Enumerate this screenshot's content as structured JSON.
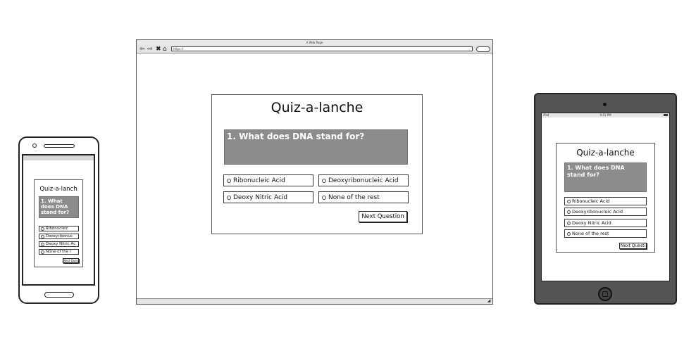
{
  "quiz": {
    "title": "Quiz-a-lanche",
    "question": "1. What does DNA stand for?",
    "options": [
      "Ribonucleic Acid",
      "Deoxyribonucleic Acid",
      "Deoxy Nitric Acid",
      "None of the rest"
    ],
    "next_label": "Next Question"
  },
  "phone": {
    "title": "Quiz-a-lanch",
    "question": "1. What does DNA stand for?",
    "options": [
      "Ribonucleic",
      "Deoxyribonuc",
      "Deoxy Nitric Ac",
      "None of the r"
    ],
    "next_label": "Next Quest"
  },
  "tablet": {
    "status_left": "iPad",
    "status_center": "9:41 PM",
    "options": [
      "Ribonucleic Acid",
      "Deoxyribonucleic Acid",
      "Deoxy Nitric Acid",
      "None of the rest"
    ],
    "next_label": "Next Questi"
  },
  "browser": {
    "window_title": "A Web Page",
    "url": "https://",
    "nav_icons": [
      "back-arrow-icon",
      "forward-arrow-icon",
      "stop-x-icon",
      "home-icon"
    ]
  }
}
